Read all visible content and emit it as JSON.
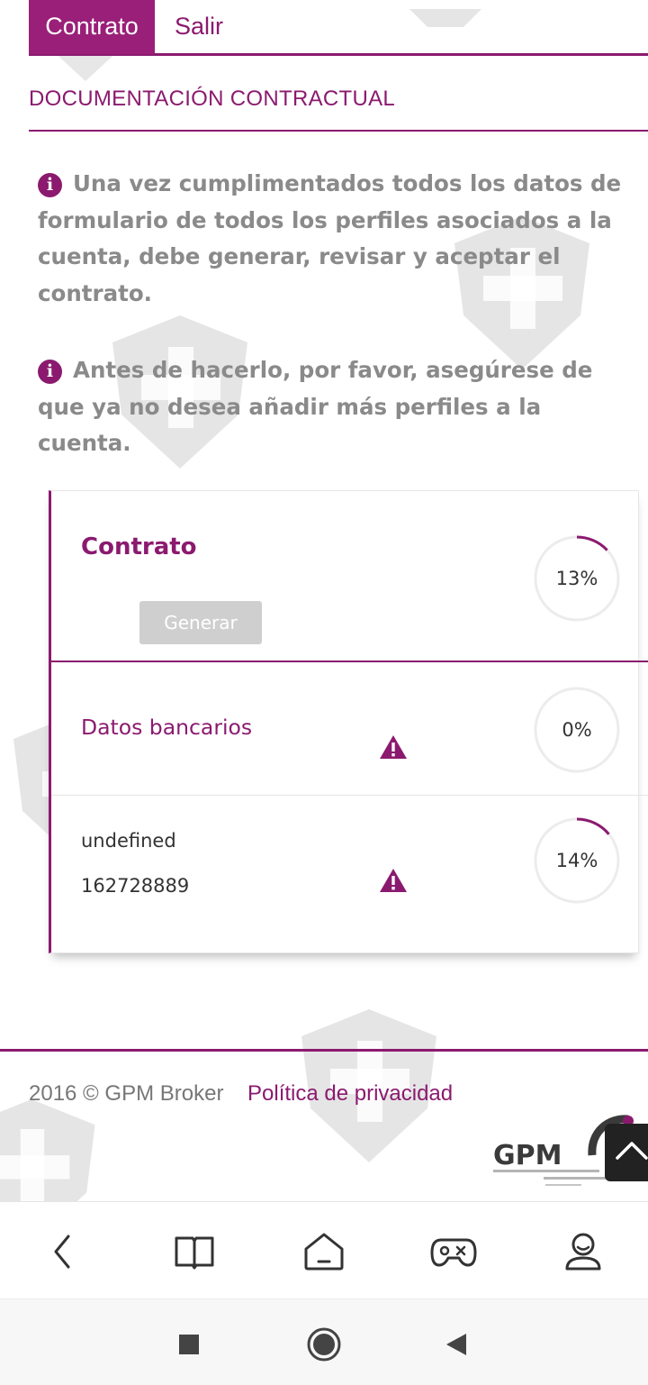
{
  "tabs": [
    {
      "label": "Contrato",
      "active": true
    },
    {
      "label": "Salir",
      "active": false
    }
  ],
  "section_title": "DOCUMENTACIÓN CONTRACTUAL",
  "info_icon": "info-circle-icon",
  "info_messages": [
    "Una vez cumplimentados todos los datos de formulario de todos los perfiles asociados a la cuenta, debe generar, revisar y aceptar el contrato.",
    "Antes de hacerlo, por favor, asegúrese de que ya no desea añadir más perfiles a la cuenta."
  ],
  "contract_card": {
    "title": "Contrato",
    "progress": 13,
    "progress_label": "13%",
    "generate_button": "Generar",
    "rows": [
      {
        "title": "Datos bancarios",
        "progress": 0,
        "progress_label": "0%",
        "icon": "warning-icon"
      },
      {
        "name": "undefined",
        "id": "162728889",
        "progress": 14,
        "progress_label": "14%",
        "icon": "warning-icon"
      }
    ]
  },
  "footer": {
    "copyright": "2016 © GPM Broker",
    "privacy_link": "Política de privacidad",
    "logo_text": "GPM"
  },
  "bottom_nav": [
    "back-icon",
    "book-icon",
    "home-icon",
    "gamepad-icon",
    "profile-icon"
  ],
  "system_nav": [
    "recents-icon",
    "home-circle-icon",
    "back-triangle-icon"
  ],
  "colors": {
    "accent": "#8b1a6f",
    "tab_active": "#9a1f78",
    "info_text": "#8a8a8a",
    "button_disabled": "#cfcfcf",
    "ring_track": "#ececec"
  }
}
